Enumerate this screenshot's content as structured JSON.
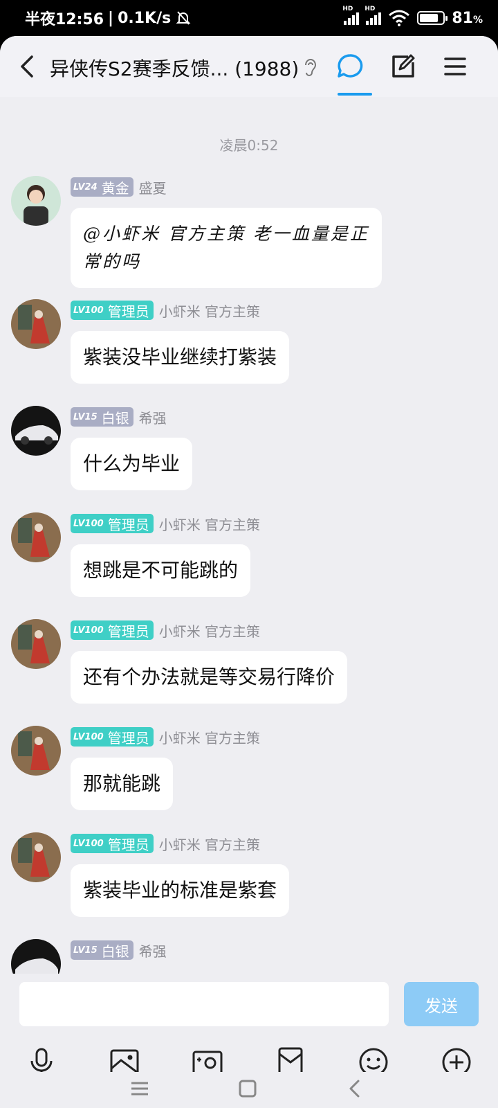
{
  "status_bar": {
    "time": "半夜12:56",
    "speed": "0.1K/s",
    "hd1": "HD",
    "hd2": "HD",
    "battery_percent": "81",
    "battery_unit": "%"
  },
  "header": {
    "title": "异侠传S2赛季反馈... (1988)"
  },
  "chat": {
    "timestamp": "凌晨0:52",
    "messages": [
      {
        "level": "LV24",
        "rank": "黄金",
        "nickname": "盛夏",
        "text_line1": "@小虾米 官方主策 老一血量是正",
        "text_line2": "常的吗"
      },
      {
        "level": "LV100",
        "rank": "管理员",
        "nickname": "小虾米 官方主策",
        "text": "紫装没毕业继续打紫装"
      },
      {
        "level": "LV15",
        "rank": "白银",
        "nickname": "希强",
        "text": "什么为毕业"
      },
      {
        "level": "LV100",
        "rank": "管理员",
        "nickname": "小虾米 官方主策",
        "text": "想跳是不可能跳的"
      },
      {
        "level": "LV100",
        "rank": "管理员",
        "nickname": "小虾米 官方主策",
        "text": "还有个办法就是等交易行降价"
      },
      {
        "level": "LV100",
        "rank": "管理员",
        "nickname": "小虾米 官方主策",
        "text": "那就能跳"
      },
      {
        "level": "LV100",
        "rank": "管理员",
        "nickname": "小虾米 官方主策",
        "text": "紫装毕业的标准是紫套"
      },
      {
        "level": "LV15",
        "rank": "白银",
        "nickname": "希强"
      }
    ]
  },
  "composer": {
    "send_label": "发送",
    "input_value": ""
  },
  "colors": {
    "accent": "#1a9bee",
    "admin_badge": "#3fcfc6",
    "rank_badge": "#a9adc4",
    "send_button": "#8dcbf6"
  }
}
